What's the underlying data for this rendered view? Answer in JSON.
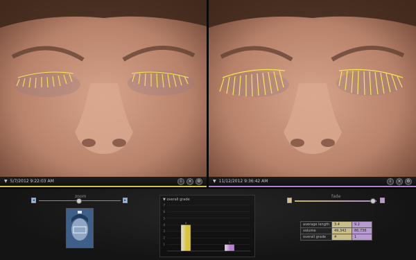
{
  "colors": {
    "before": "#d9c53a",
    "after": "#b77fd1",
    "lash": "#f4e94a"
  },
  "left_panel": {
    "datetime": "5/7/2012  9:22:03 AM",
    "icons": [
      "info-icon",
      "close-icon",
      "gear-icon"
    ]
  },
  "right_panel": {
    "datetime": "11/12/2012  9:36:42 AM",
    "icons": [
      "info-icon",
      "close-icon",
      "gear-icon"
    ]
  },
  "zoom": {
    "label": "zoom",
    "level": 0.48
  },
  "fade": {
    "label": "fade",
    "level": 0.95
  },
  "chart_title": "overall grade",
  "chart_data": {
    "type": "bar",
    "title": "overall grade",
    "categories": [
      "5/7/2012",
      "11/12/2012"
    ],
    "values": [
      4,
      1
    ],
    "ylim": [
      0,
      7
    ],
    "ticks": [
      "7",
      "6",
      "5",
      "4",
      "3",
      "2",
      "1"
    ],
    "grid": true
  },
  "stats": {
    "rows": [
      {
        "label": "average length",
        "before": "3.4",
        "after": "9.2"
      },
      {
        "label": "volume",
        "before": "49,342",
        "after": "86,736"
      },
      {
        "label": "overall grade",
        "before": "4",
        "after": "1"
      }
    ]
  }
}
